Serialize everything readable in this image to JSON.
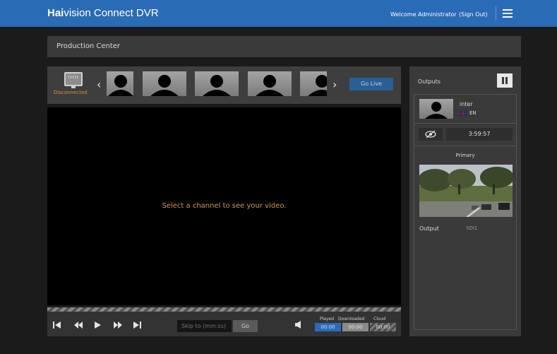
{
  "header": {
    "brand_bold": "Hai",
    "brand_rest": "vision Connect DVR",
    "welcome": "Welcome Administrator",
    "signout": "(Sign Out)",
    "bar_color": "#2a6bb6"
  },
  "page": {
    "title": "Production Center"
  },
  "channels": {
    "status": "Disconnected",
    "go_live": "Go Live",
    "thumbnail_count": 5
  },
  "video": {
    "message": "Select a channel to see your video."
  },
  "controls": {
    "skip_placeholder": "Skip to (mm:ss)",
    "go": "Go",
    "legend": {
      "played": {
        "label": "Played",
        "value": "00:00",
        "color": "#2a6bb6"
      },
      "downloaded": {
        "label": "Downloaded",
        "value": "00:00",
        "color": "#8a8a8a"
      },
      "cloud": {
        "label": "Cloud",
        "value": "00:00",
        "color": "#555555"
      }
    }
  },
  "outputs": {
    "title": "Outputs",
    "item": {
      "name": "inter",
      "language": "EN"
    },
    "timer": "3:59:57",
    "primary_label": "Primary",
    "output_label": "Output",
    "output_value": "SDI1"
  }
}
